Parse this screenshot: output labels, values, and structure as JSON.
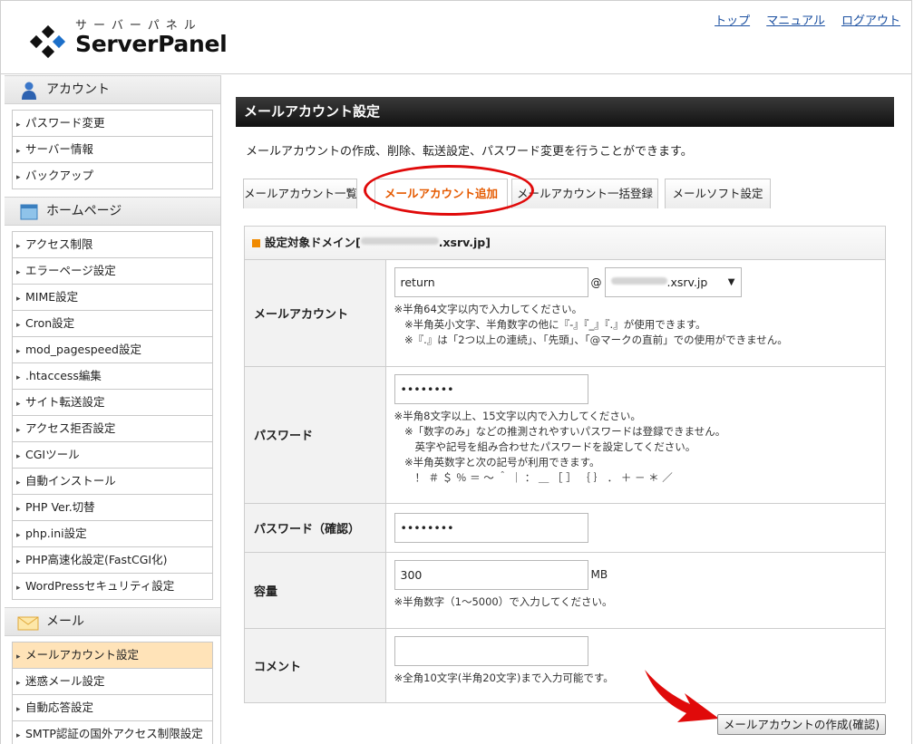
{
  "header": {
    "logo_kana": "サーバーパネル",
    "logo_name": "ServerPanel",
    "links": [
      "トップ",
      "マニュアル",
      "ログアウト"
    ]
  },
  "sidebar": {
    "sections": [
      {
        "title": "アカウント",
        "icon": "user-icon",
        "items": [
          "パスワード変更",
          "サーバー情報",
          "バックアップ"
        ]
      },
      {
        "title": "ホームページ",
        "icon": "window-icon",
        "items": [
          "アクセス制限",
          "エラーページ設定",
          "MIME設定",
          "Cron設定",
          "mod_pagespeed設定",
          ".htaccess編集",
          "サイト転送設定",
          "アクセス拒否設定",
          "CGIツール",
          "自動インストール",
          "PHP Ver.切替",
          "php.ini設定",
          "PHP高速化設定(FastCGI化)",
          "WordPressセキュリティ設定"
        ]
      },
      {
        "title": "メール",
        "icon": "envelope-icon",
        "items": [
          "メールアカウント設定",
          "迷惑メール設定",
          "自動応答設定",
          "SMTP認証の国外アクセス制限設定"
        ],
        "active": 0
      }
    ]
  },
  "main": {
    "title": "メールアカウント設定",
    "description": "メールアカウントの作成、削除、転送設定、パスワード変更を行うことができます。",
    "tabs": [
      "メールアカウント一覧",
      "メールアカウント追加",
      "メールアカウント一括登録",
      "メールソフト設定"
    ],
    "active_tab": 1,
    "domain_bar": {
      "prefix": "設定対象ドメイン[",
      "domain_suffix": ".xsrv.jp]"
    },
    "form": {
      "account": {
        "label": "メールアカウント",
        "value": "return",
        "at": "@",
        "domain_value": ".xsrv.jp",
        "notes": [
          "※半角64文字以内で入力してください。",
          "　※半角英小文字、半角数字の他に『-』『_』『.』が使用できます。",
          "　※『.』は「2つ以上の連続」、「先頭」、「@マークの直前」での使用ができません。"
        ]
      },
      "password": {
        "label": "パスワード",
        "value": "••••••••",
        "notes": [
          "※半角8文字以上、15文字以内で入力してください。",
          "　※「数字のみ」などの推測されやすいパスワードは登録できません。",
          "　　英字や記号を組み合わせたパスワードを設定してください。",
          "　※半角英数字と次の記号が利用できます。",
          "　　！ ＃ ＄ ％ ＝ ～ ＾ ｜ ： ＿ ［ ］ ｛ ｝ ． ＋ － ＊ ／"
        ]
      },
      "password_confirm": {
        "label": "パスワード（確認）",
        "value": "••••••••"
      },
      "capacity": {
        "label": "容量",
        "value": "300",
        "unit": "MB",
        "notes": [
          "※半角数字（1～5000）で入力してください。"
        ]
      },
      "comment": {
        "label": "コメント",
        "value": "",
        "notes": [
          "※全角10文字(半角20文字)まで入力可能です。"
        ]
      }
    },
    "submit_label": "メールアカウントの作成(確認)"
  },
  "colors": {
    "active_tab_text": "#e55a00",
    "highlight_ring": "#e00a0a",
    "active_menu_bg": "#ffe3b8",
    "title_bar": "#1a1a1a"
  }
}
